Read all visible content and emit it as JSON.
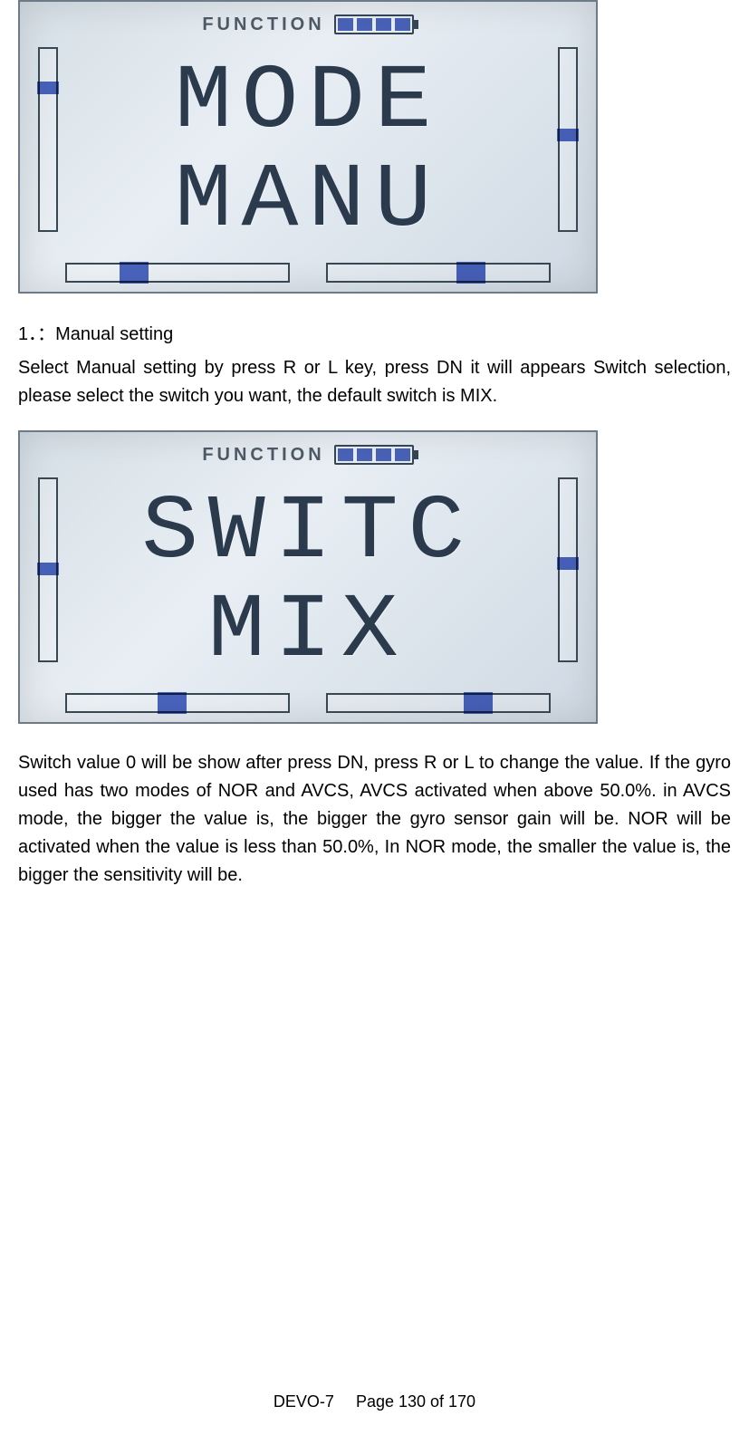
{
  "lcd1": {
    "top_label": "FUNCTION",
    "battery_cells": 4,
    "line1": "MODE",
    "line2": "MANU"
  },
  "section_heading": "1．：Manual setting",
  "paragraph1": "Select Manual setting by press R or L key, press DN it will appears Switch selection, please select the switch you want, the default switch is MIX.",
  "lcd2": {
    "top_label": "FUNCTION",
    "battery_cells": 4,
    "line1": "SWITC",
    "line2": "MIX"
  },
  "paragraph2": "Switch value 0 will be show after press DN, press R or L to change the value. If the gyro used has two modes of NOR and AVCS, AVCS activated when above 50.0%. in AVCS mode, the bigger the value is, the bigger the gyro sensor gain will be. NOR will be activated when the value is less than 50.0%, In NOR mode, the smaller the value is, the bigger the sensitivity will be.",
  "footer": {
    "model": "DEVO-7",
    "page_label": "Page 130 of 170"
  }
}
